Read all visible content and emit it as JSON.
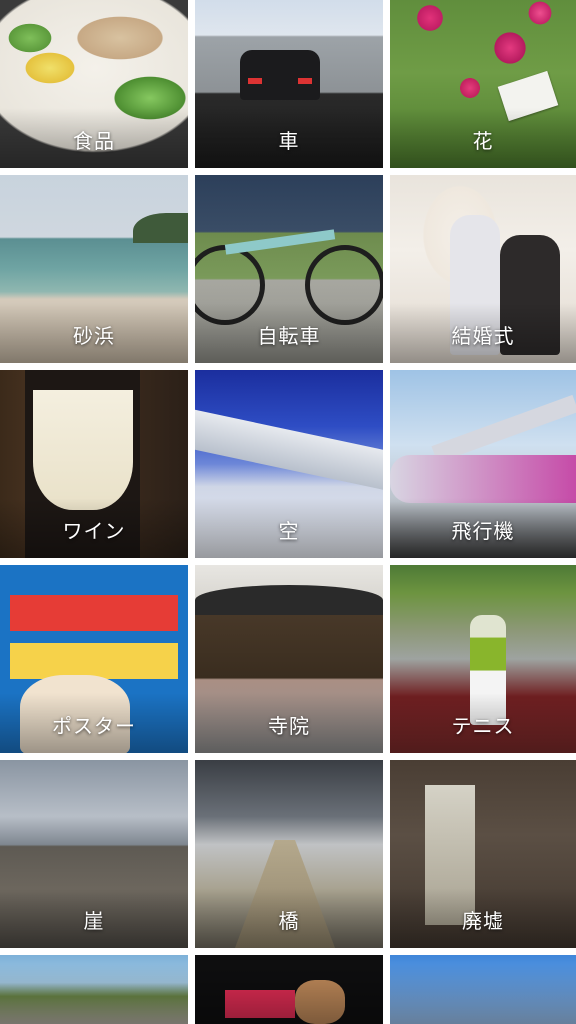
{
  "grid": {
    "tiles": [
      {
        "label": "食品"
      },
      {
        "label": "車"
      },
      {
        "label": "花"
      },
      {
        "label": "砂浜"
      },
      {
        "label": "自転車"
      },
      {
        "label": "結婚式"
      },
      {
        "label": "ワイン"
      },
      {
        "label": "空"
      },
      {
        "label": "飛行機"
      },
      {
        "label": "ポスター"
      },
      {
        "label": "寺院"
      },
      {
        "label": "テニス"
      },
      {
        "label": "崖"
      },
      {
        "label": "橋"
      },
      {
        "label": "廃墟"
      },
      {
        "label": ""
      },
      {
        "label": ""
      },
      {
        "label": ""
      }
    ]
  }
}
